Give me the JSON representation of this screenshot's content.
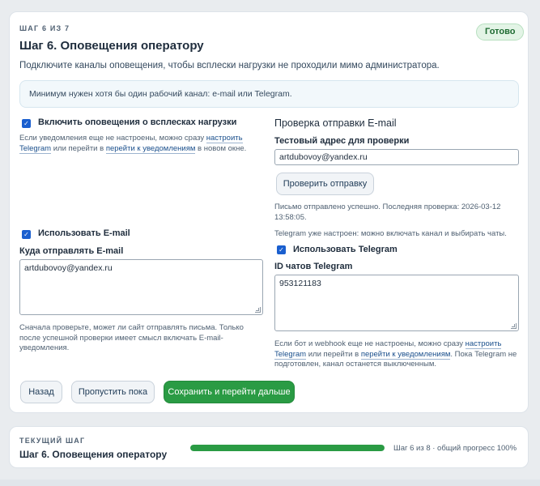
{
  "header": {
    "step_label": "ШАГ 6 ИЗ 7",
    "badge": "Готово",
    "title": "Шаг 6. Оповещения оператору",
    "subtitle": "Подключите каналы оповещения, чтобы всплески нагрузки не проходили мимо администратора."
  },
  "info_box": {
    "text": "Минимум нужен хотя бы один рабочий канал: e-mail или Telegram."
  },
  "left": {
    "spike_alerts": {
      "checked": true,
      "label": "Включить оповещения о всплесках нагрузки",
      "hint_before": "Если уведомления еще не настроены, можно сразу",
      "link_telegram": "настроить Telegram",
      "hint_middle": "или перейти в",
      "link_notifications": "перейти к уведомлениям",
      "hint_after": "в новом окне."
    },
    "email": {
      "checked": true,
      "label": "Использовать E-mail",
      "field_label": "Куда отправлять E-mail",
      "value": "artdubovoy@yandex.ru",
      "hint": "Сначала проверьте, может ли сайт отправлять письма. Только после успешной проверки имеет смысл включать E-mail-уведомления."
    }
  },
  "right": {
    "email_test": {
      "section_title": "Проверка отправки E-mail",
      "field_label": "Тестовый адрес для проверки",
      "value": "artdubovoy@yandex.ru",
      "button": "Проверить отправку",
      "status": "Письмо отправлено успешно. Последняя проверка: 2026-03-12 13:58:05."
    },
    "telegram": {
      "status": "Telegram уже настроен: можно включать канал и выбирать чаты.",
      "checked": true,
      "label": "Использовать Telegram",
      "field_label": "ID чатов Telegram",
      "value": "953121183",
      "hint_before": "Если бот и webhook еще не настроены, можно сразу",
      "link_telegram": "настроить Telegram",
      "hint_middle": "или перейти в",
      "link_notifications": "перейти к уведомлениям",
      "hint_after": ". Пока Telegram не подготовлен, канал останется выключенным."
    }
  },
  "actions": {
    "back": "Назад",
    "skip": "Пропустить пока",
    "save": "Сохранить и перейти дальше"
  },
  "current_step": {
    "label": "ТЕКУЩИЙ ШАГ",
    "title": "Шаг 6. Оповещения оператору",
    "progress_percent": 100,
    "progress_text": "Шаг 6 из 8 · общий прогресс 100%"
  },
  "colors": {
    "primary": "#2a9b44",
    "link": "#1a4f8c",
    "checkbox": "#1a5fcf"
  }
}
